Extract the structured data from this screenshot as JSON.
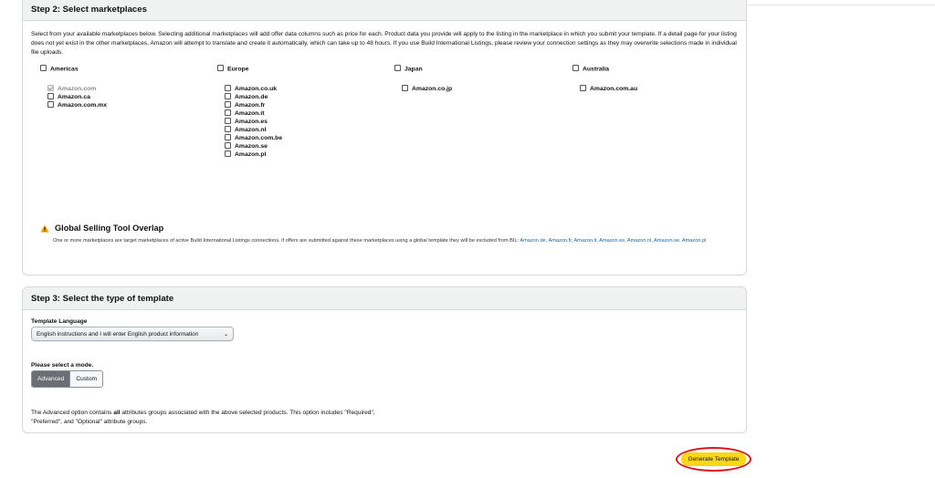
{
  "step2": {
    "title": "Step 2: Select marketplaces",
    "description": "Select from your available marketplaces below. Selecting additional marketplaces will add offer data columns such as price for each. Product data you provide will apply to the listing in the marketplace in which you submit your template. If a detail page for your listing does not yet exist in the other marketplaces, Amazon will attempt to translate and create it automatically, which can take up to 48 hours. If you use Build International Listings, please review your connection settings as they may overwrite selections made in individual file uploads.",
    "regions": [
      {
        "label": "Americas",
        "marketplaces": [
          {
            "label": "Amazon.com",
            "checked": true,
            "disabled": true
          },
          {
            "label": "Amazon.ca",
            "checked": false,
            "disabled": false
          },
          {
            "label": "Amazon.com.mx",
            "checked": false,
            "disabled": false
          }
        ]
      },
      {
        "label": "Europe",
        "marketplaces": [
          {
            "label": "Amazon.co.uk",
            "checked": false
          },
          {
            "label": "Amazon.de",
            "checked": false
          },
          {
            "label": "Amazon.fr",
            "checked": false
          },
          {
            "label": "Amazon.it",
            "checked": false
          },
          {
            "label": "Amazon.es",
            "checked": false
          },
          {
            "label": "Amazon.nl",
            "checked": false
          },
          {
            "label": "Amazon.com.be",
            "checked": false
          },
          {
            "label": "Amazon.se",
            "checked": false
          },
          {
            "label": "Amazon.pl",
            "checked": false
          }
        ]
      },
      {
        "label": "Japan",
        "marketplaces": [
          {
            "label": "Amazon.co.jp",
            "checked": false
          }
        ]
      },
      {
        "label": "Australia",
        "marketplaces": [
          {
            "label": "Amazon.com.au",
            "checked": false
          }
        ]
      }
    ],
    "warning": {
      "title": "Global Selling Tool Overlap",
      "text": "One or more marketplaces are target marketplaces of active Build International Listings connections, if offers are submitted against these marketplaces using a global template they will be excluded from BIL: ",
      "links": "Amazon.de, Amazon.fr, Amazon.it, Amazon.es, Amazon.nl, Amazon.se, Amazon.pl",
      "icon_color": "#f0a30a"
    }
  },
  "step3": {
    "title": "Step 3: Select the type of template",
    "language_label": "Template Language",
    "language_value": "English instructions and I will enter English product information",
    "mode_label": "Please select a mode.",
    "modes": [
      "Advanced",
      "Custom"
    ],
    "selected_mode": "Advanced",
    "note_prefix": "The Advanced option contains ",
    "note_bold": "all",
    "note_suffix": " attributes groups associated with the above selected products. This option includes \"Required\", \"Preferred\", and \"Optional\" attribute groups."
  },
  "actions": {
    "generate_label": "Generate Template",
    "button_color": "#ffd814",
    "highlight_color": "#e3101e"
  }
}
